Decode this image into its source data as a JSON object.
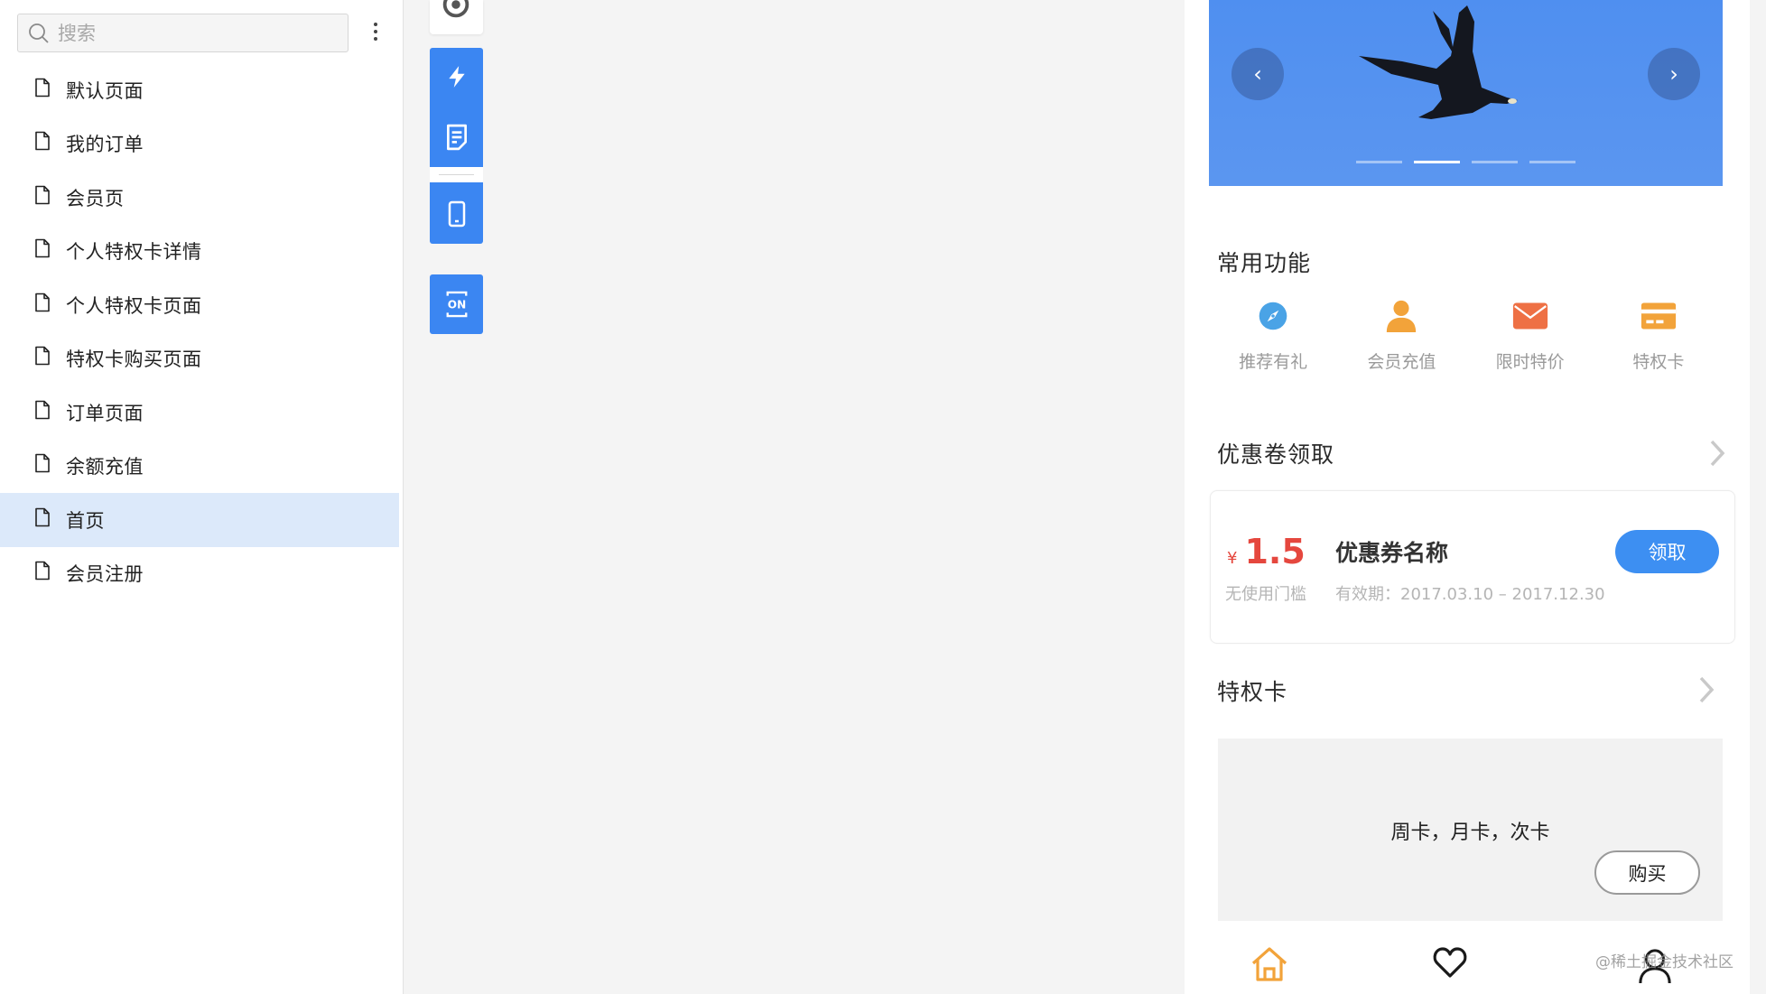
{
  "sidebar": {
    "search": {
      "placeholder": "搜索",
      "value": ""
    },
    "more_icon": "kebab-vertical-icon",
    "items": [
      {
        "label": "默认页面",
        "icon": "document-icon",
        "active": false
      },
      {
        "label": "我的订单",
        "icon": "document-icon",
        "active": false
      },
      {
        "label": "会员页",
        "icon": "document-icon",
        "active": false
      },
      {
        "label": "个人特权卡详情",
        "icon": "document-icon",
        "active": false
      },
      {
        "label": "个人特权卡页面",
        "icon": "document-icon",
        "active": false
      },
      {
        "label": "特权卡购买页面",
        "icon": "document-icon",
        "active": false
      },
      {
        "label": "订单页面",
        "icon": "document-icon",
        "active": false
      },
      {
        "label": "余额充值",
        "icon": "document-icon",
        "active": false
      },
      {
        "label": "首页",
        "icon": "document-icon",
        "active": true
      },
      {
        "label": "会员注册",
        "icon": "document-icon",
        "active": false
      }
    ]
  },
  "toolbar": {
    "buttons": [
      "target-icon",
      "lightning-icon",
      "page-icon",
      "mobile-icon",
      "on-toggle-icon"
    ],
    "accent": "#3b86f2"
  },
  "preview": {
    "banner": {
      "prev": "‹",
      "next": "›",
      "active_dot": 1,
      "dot_count": 4
    },
    "common": {
      "title": "常用功能",
      "items": [
        {
          "label": "推荐有礼",
          "icon": "compass-icon",
          "color": "#4aa3e6"
        },
        {
          "label": "会员充值",
          "icon": "user-icon",
          "color": "#f2a33a"
        },
        {
          "label": "限时特价",
          "icon": "mail-icon",
          "color": "#ee7044"
        },
        {
          "label": "特权卡",
          "icon": "card-icon",
          "color": "#f2a33a"
        }
      ]
    },
    "coupon_section": {
      "title": "优惠卷领取",
      "currency": "¥",
      "amount": "1.5",
      "threshold": "无使用门槛",
      "name": "优惠券名称",
      "validity": "有效期：2017.03.10 – 2017.12.30",
      "button": "领取",
      "price_color": "#e5473e"
    },
    "card_section": {
      "title": "特权卡",
      "text": "周卡，月卡，次卡",
      "button": "购买"
    },
    "tabbar": [
      "home-icon",
      "heart-icon",
      "user-icon"
    ],
    "watermark": "@稀土掘金技术社区"
  }
}
